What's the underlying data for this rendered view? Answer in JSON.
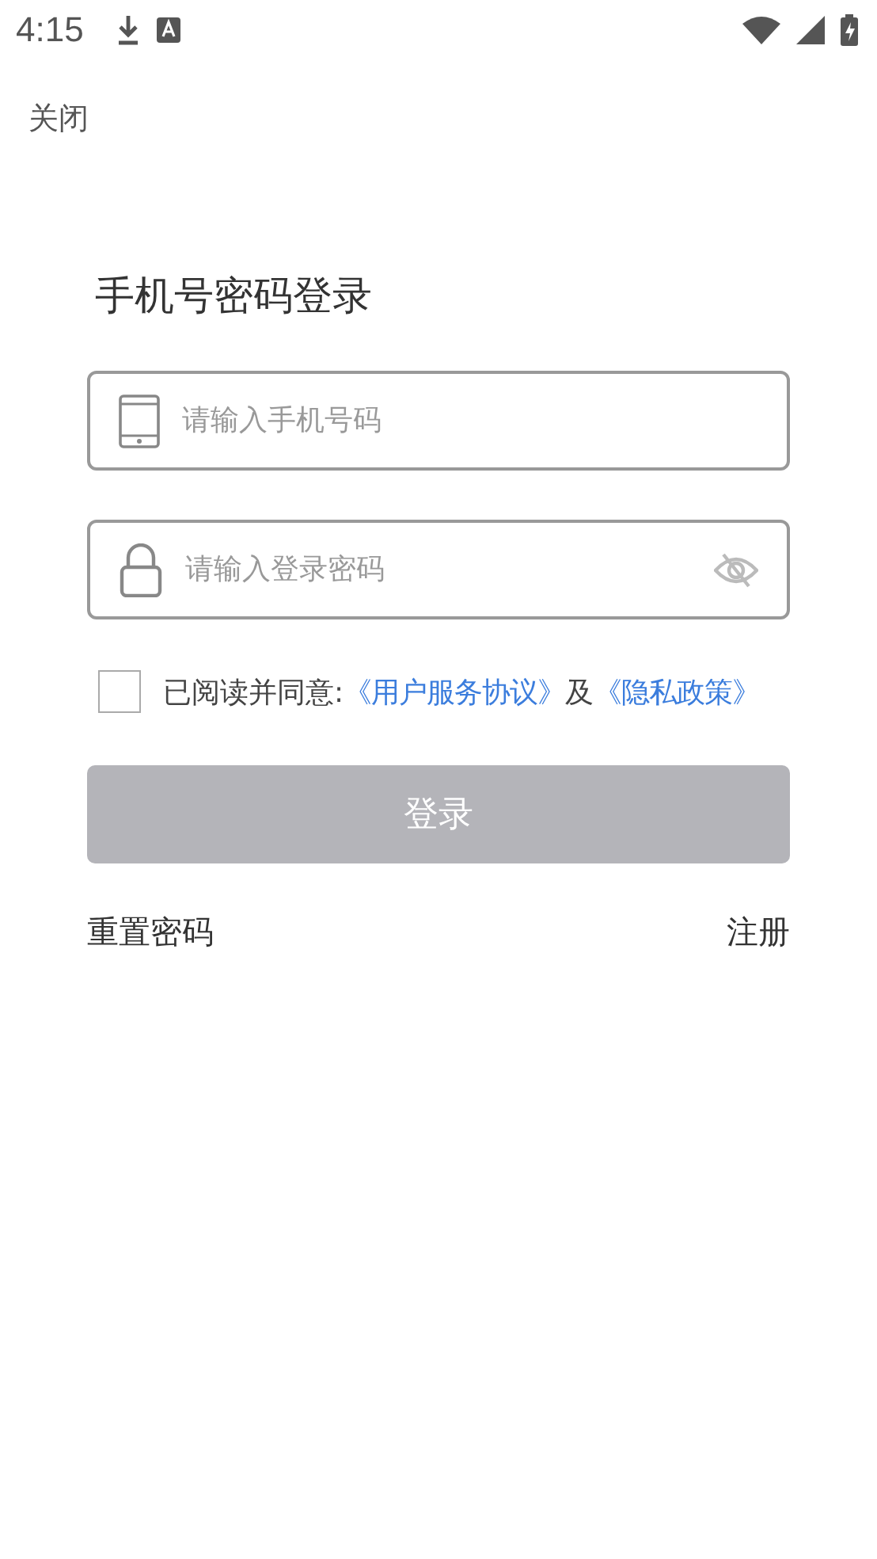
{
  "status_bar": {
    "time": "4:15"
  },
  "close": "关闭",
  "title": "手机号密码登录",
  "phone_field": {
    "placeholder": "请输入手机号码"
  },
  "password_field": {
    "placeholder": "请输入登录密码",
    "visible": false
  },
  "agreement": {
    "checked": false,
    "prefix": "已阅读并同意:",
    "terms_link": "《用户服务协议》",
    "joiner": "及",
    "privacy_link": "《隐私政策》"
  },
  "login_button": {
    "label": "登录",
    "disabled": true
  },
  "reset_link": "重置密码",
  "register_link": "注册"
}
